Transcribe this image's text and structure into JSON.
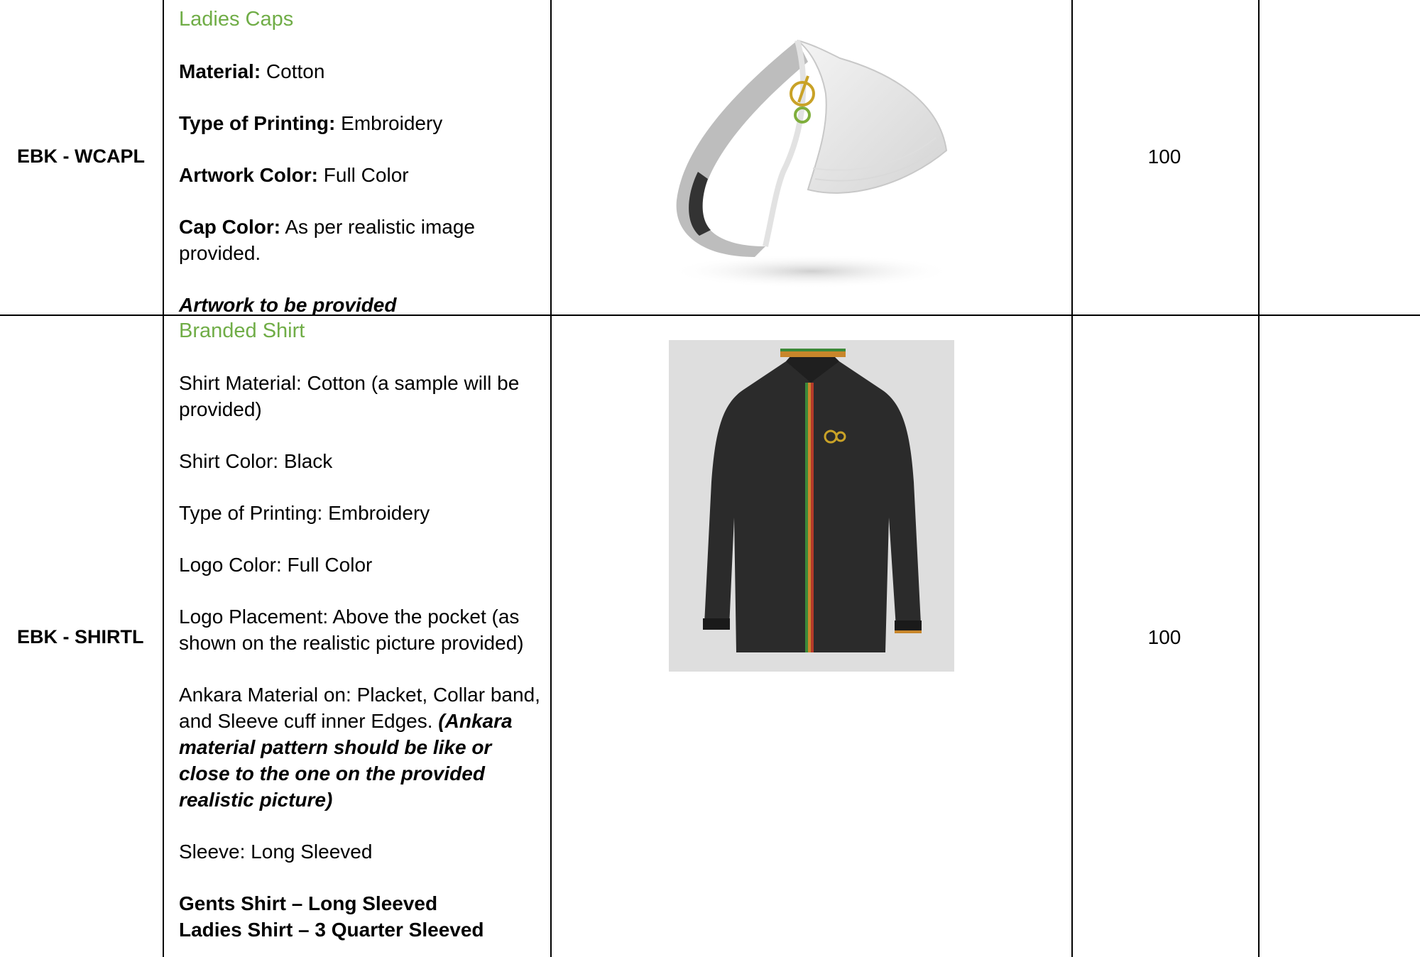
{
  "rows": [
    {
      "code": "EBK - WCAPL",
      "heading": "Ladies Caps",
      "material_label": "Material:",
      "material_value": " Cotton",
      "printing_label": "Type of Printing:",
      "printing_value": " Embroidery",
      "artwork_label": "Artwork Color:",
      "artwork_value": " Full Color",
      "capcolor_label": "Cap Color:",
      "capcolor_value": " As per realistic image provided.",
      "note": "Artwork to be provided",
      "quantity": "100",
      "image_icon": "visor-cap-image"
    },
    {
      "code": "EBK - SHIRTL",
      "heading": "Branded Shirt",
      "lines": [
        "Shirt Material: Cotton (a sample will be provided)",
        "Shirt Color: Black",
        "Type of Printing: Embroidery",
        "Logo Color: Full Color",
        "Logo Placement: Above the pocket (as shown on the realistic picture provided)"
      ],
      "ankara_text": "Ankara Material on: Placket, Collar band, and Sleeve cuff inner Edges.",
      "ankara_note": "(Ankara material pattern should be like or close to the one on the provided realistic picture)",
      "sleeve": "Sleeve: Long Sleeved",
      "gents": "Gents Shirt – Long Sleeved",
      "ladies": "Ladies Shirt – 3 Quarter Sleeved",
      "quantity": "100",
      "image_icon": "black-shirt-image"
    }
  ],
  "colors": {
    "heading_green": "#70ad47",
    "border": "#000000"
  }
}
